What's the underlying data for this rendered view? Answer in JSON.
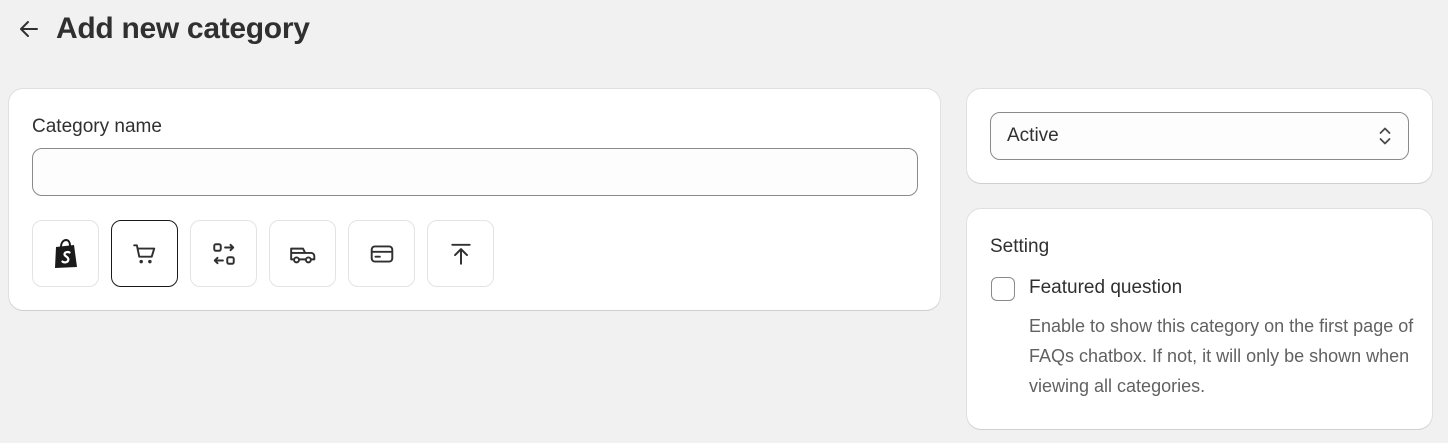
{
  "header": {
    "title": "Add new category",
    "back_icon": "arrow-left-icon"
  },
  "category_form": {
    "name_label": "Category name",
    "name_value": "",
    "name_placeholder": "",
    "icons": [
      {
        "name": "shopify-bag-icon",
        "selected": false
      },
      {
        "name": "cart-icon",
        "selected": true
      },
      {
        "name": "exchange-icon",
        "selected": false
      },
      {
        "name": "delivery-truck-icon",
        "selected": false
      },
      {
        "name": "credit-card-icon",
        "selected": false
      },
      {
        "name": "upload-icon",
        "selected": false
      }
    ]
  },
  "status": {
    "selected": "Active"
  },
  "setting": {
    "title": "Setting",
    "featured_label": "Featured question",
    "featured_checked": false,
    "featured_help": "Enable to show this category on the first page of FAQs chatbox. If not, it will only be shown when viewing all categories."
  },
  "colors": {
    "background": "#f1f1f1",
    "card": "#ffffff",
    "text": "#303030",
    "muted_text": "#616161",
    "border": "#8a8a8a",
    "selected_border": "#1a1a1a"
  }
}
